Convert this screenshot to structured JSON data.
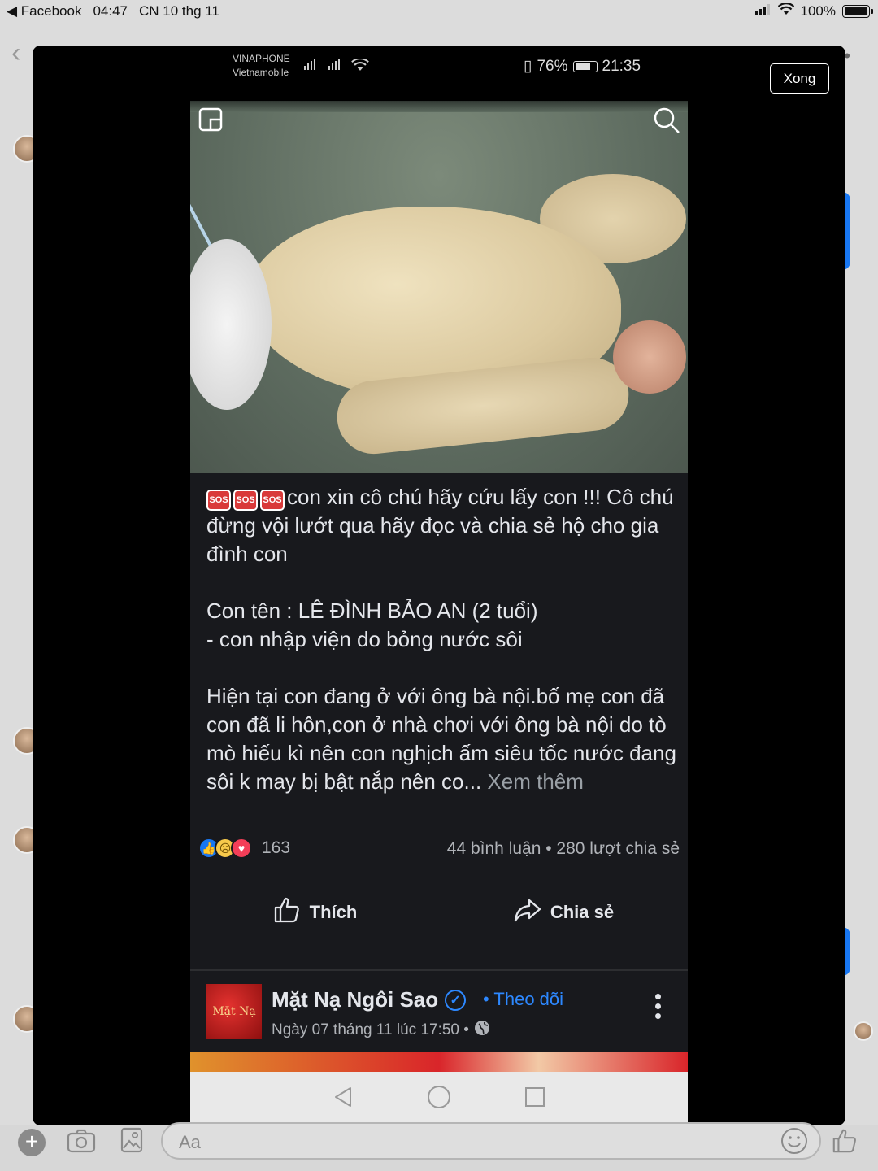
{
  "ios_status": {
    "app_back": "◀ Facebook",
    "time": "04:47",
    "date": "CN 10 thg 11",
    "battery": "100%"
  },
  "viewer": {
    "done_label": "Xong"
  },
  "android_status": {
    "carrier1": "VINAPHONE",
    "carrier2": "Vietnamobile",
    "battery": "76%",
    "time": "21:35"
  },
  "post": {
    "text_line1": "con xin cô chú hãy cứu lấy con !!! Cô chú đừng vội lướt qua hãy đọc và chia sẻ hộ cho gia đình con",
    "text_line2": "Con tên : LÊ ĐÌNH BẢO AN (2 tuổi)",
    "text_line3": " - con nhập viện do bỏng nước sôi",
    "text_line4": "Hiện tại con đang ở với ông bà nội.bố mẹ con đã con đã li hôn,con ở nhà chơi với ông bà nội do tò mò hiếu kì  nên con nghịch ấm siêu tốc nước đang sôi k may bị bật nắp nên co...",
    "see_more": " Xem thêm",
    "sos_label": "SOS",
    "reaction_count": "163",
    "stats": "44 bình luận • 280 lượt chia sẻ",
    "like_label": "Thích",
    "share_label": "Chia sẻ"
  },
  "next_post": {
    "page_name": "Mặt Nạ Ngôi Sao",
    "follow_label": "• Theo dõi",
    "date": "Ngày 07 tháng 11 lúc 17:50 •",
    "avatar_text": "Mặt Nạ"
  },
  "composer": {
    "placeholder": "Aa"
  },
  "colors": {
    "facebook_blue": "#1877f2",
    "dark_bg": "#18191d",
    "text_light": "#e4e6eb"
  }
}
